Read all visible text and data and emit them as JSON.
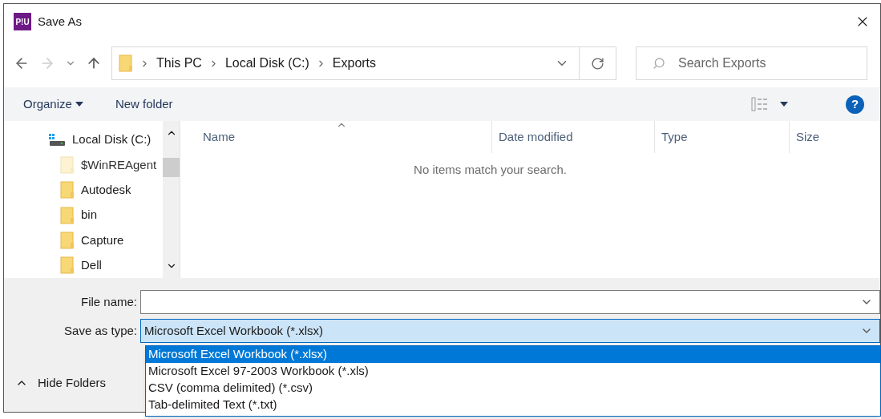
{
  "window": {
    "title": "Save As",
    "app_icon_text": "P!U"
  },
  "address_bar": {
    "segments": [
      "This PC",
      "Local Disk (C:)",
      "Exports"
    ]
  },
  "search": {
    "placeholder": "Search Exports"
  },
  "toolbar": {
    "organize": "Organize",
    "new_folder": "New folder"
  },
  "sidebar": {
    "items": [
      {
        "label": "Local Disk (C:)",
        "kind": "drive",
        "hidden": false
      },
      {
        "label": "$WinREAgent",
        "kind": "folder",
        "hidden": true
      },
      {
        "label": "Autodesk",
        "kind": "folder",
        "hidden": false
      },
      {
        "label": "bin",
        "kind": "folder",
        "hidden": false
      },
      {
        "label": "Capture",
        "kind": "folder",
        "hidden": false
      },
      {
        "label": "Dell",
        "kind": "folder",
        "hidden": false
      }
    ]
  },
  "file_list": {
    "columns": [
      {
        "label": "Name",
        "sorted": true
      },
      {
        "label": "Date modified",
        "sorted": false
      },
      {
        "label": "Type",
        "sorted": false
      },
      {
        "label": "Size",
        "sorted": false
      }
    ],
    "empty_message": "No items match your search."
  },
  "form": {
    "file_name_label": "File name:",
    "save_as_type_label": "Save as type:",
    "save_as_type_value": "Microsoft Excel Workbook (*.xlsx)",
    "options": [
      {
        "label": "Microsoft Excel Workbook (*.xlsx)",
        "selected": true
      },
      {
        "label": "Microsoft Excel 97-2003 Workbook (*.xls)",
        "selected": false
      },
      {
        "label": "CSV (comma delimited) (*.csv)",
        "selected": false
      },
      {
        "label": "Tab-delimited Text (*.txt)",
        "selected": false
      }
    ]
  },
  "hide_folders": "Hide Folders",
  "help_icon_text": "?"
}
